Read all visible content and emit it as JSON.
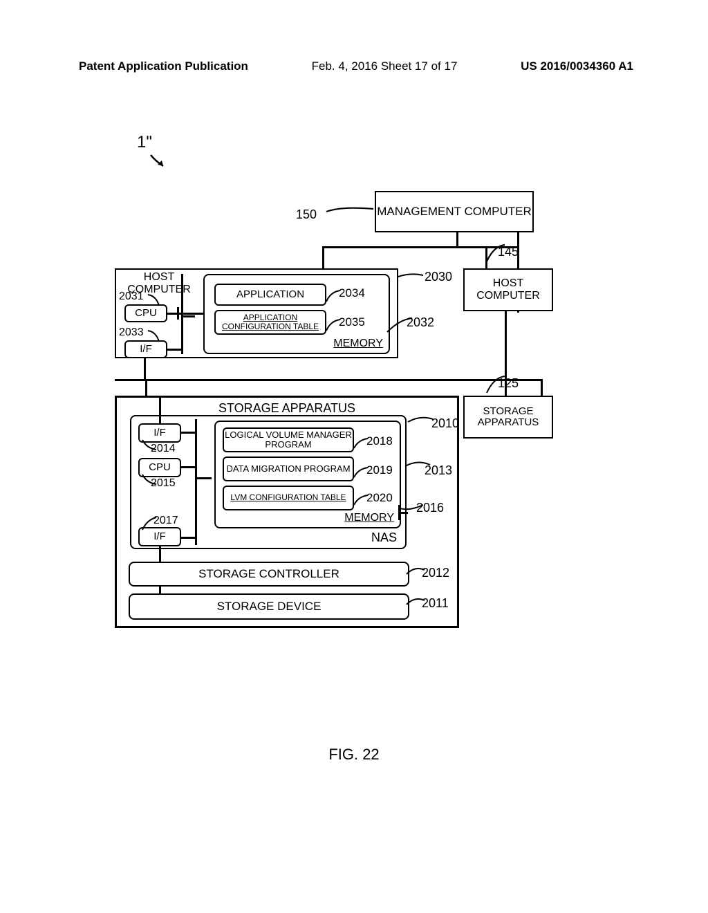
{
  "header": {
    "left": "Patent Application Publication",
    "mid": "Feb. 4, 2016  Sheet 17 of 17",
    "right": "US 2016/0034360 A1"
  },
  "figure_caption": "FIG. 22",
  "diagram_ref": "1\"",
  "blocks": {
    "management_computer": "MANAGEMENT COMPUTER",
    "host_computer": "HOST COMPUTER",
    "host_computer_right": "HOST COMPUTER",
    "cpu_host": "CPU",
    "if_host": "I/F",
    "application": "APPLICATION",
    "app_cfg_table": "APPLICATION CONFIGURATION TABLE",
    "memory_host": "MEMORY",
    "storage_apparatus": "STORAGE APPARATUS",
    "storage_apparatus_right": "STORAGE APPARATUS",
    "if_nas_top": "I/F",
    "cpu_nas": "CPU",
    "if_nas_bottom": "I/F",
    "lvm_program": "LOGICAL VOLUME MANAGER PROGRAM",
    "data_migration": "DATA MIGRATION PROGRAM",
    "lvm_cfg_table": "LVM CONFIGURATION TABLE",
    "memory_nas": "MEMORY",
    "nas": "NAS",
    "storage_controller": "STORAGE CONTROLLER",
    "storage_device": "STORAGE DEVICE"
  },
  "refs": {
    "150": "150",
    "145": "145",
    "2030": "2030",
    "2031": "2031",
    "2032": "2032",
    "2033": "2033",
    "2034": "2034",
    "2035": "2035",
    "125": "125",
    "2010": "2010",
    "2011": "2011",
    "2012": "2012",
    "2013": "2013",
    "2014": "2014",
    "2015": "2015",
    "2016": "2016",
    "2017": "2017",
    "2018": "2018",
    "2019": "2019",
    "2020": "2020"
  }
}
